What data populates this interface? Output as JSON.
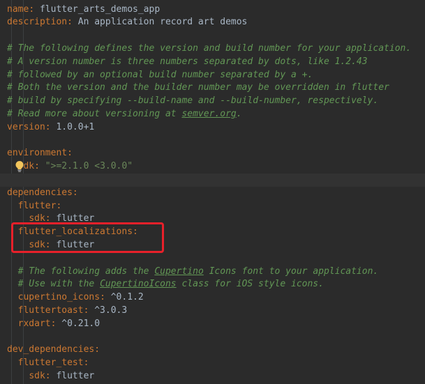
{
  "lines": [
    {
      "key": "name",
      "sep": ": ",
      "value": "flutter_arts_demos_app"
    },
    {
      "key": "description",
      "sep": ": ",
      "value": "An application record art demos"
    },
    {
      "blank": true
    },
    {
      "comment": "# The following defines the version and build number for your application."
    },
    {
      "comment": "# A version number is three numbers separated by dots, like 1.2.43"
    },
    {
      "comment": "# followed by an optional build number separated by a +."
    },
    {
      "comment": "# Both the version and the builder number may be overridden in flutter"
    },
    {
      "comment": "# build by specifying --build-name and --build-number, respectively."
    },
    {
      "comment_pre": "# Read more about versioning at ",
      "comment_link": "semver.org",
      "comment_post": "."
    },
    {
      "key": "version",
      "sep": ": ",
      "value": "1.0.0+1"
    },
    {
      "blank": true
    },
    {
      "key": "environment",
      "sep": ":"
    },
    {
      "indent": "  ",
      "key": "sdk",
      "sep": ": ",
      "string": "\">=2.1.0 <3.0.0\""
    },
    {
      "blank": true,
      "highlighted": true
    },
    {
      "key": "dependencies",
      "sep": ":"
    },
    {
      "indent": "  ",
      "key": "flutter",
      "sep": ":"
    },
    {
      "indent": "    ",
      "key": "sdk",
      "sep": ": ",
      "value": "flutter"
    },
    {
      "indent": "  ",
      "key": "flutter_localizations",
      "sep": ":"
    },
    {
      "indent": "    ",
      "key": "sdk",
      "sep": ": ",
      "value": "flutter"
    },
    {
      "blank": true
    },
    {
      "indent": "  ",
      "comment_pre": "# The following adds the ",
      "comment_link": "Cupertino",
      "comment_post": " Icons font to your application."
    },
    {
      "indent": "  ",
      "comment_pre": "# Use with the ",
      "comment_link": "CupertinoIcons",
      "comment_post": " class for iOS style icons."
    },
    {
      "indent": "  ",
      "key": "cupertino_icons",
      "sep": ": ",
      "value": "^0.1.2"
    },
    {
      "indent": "  ",
      "key": "fluttertoast",
      "sep": ": ",
      "value": "^3.0.3"
    },
    {
      "indent": "  ",
      "key": "rxdart",
      "sep": ": ",
      "value": "^0.21.0"
    },
    {
      "blank": true
    },
    {
      "key": "dev_dependencies",
      "sep": ":"
    },
    {
      "indent": "  ",
      "key": "flutter_test",
      "sep": ":"
    },
    {
      "indent": "    ",
      "key": "sdk",
      "sep": ": ",
      "value": "flutter"
    }
  ],
  "colors": {
    "background": "#2b2b2b",
    "key": "#cc7832",
    "value": "#a9b7c6",
    "string": "#6a8759",
    "comment": "#629755",
    "highlight_box": "#e8202a"
  },
  "icons": {
    "intention": "lightbulb-icon"
  }
}
